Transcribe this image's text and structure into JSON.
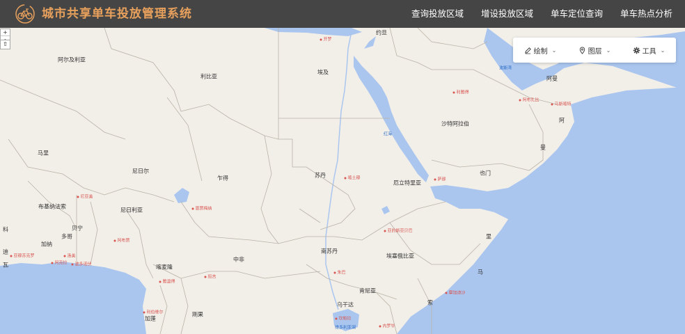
{
  "header": {
    "title": "城市共享单车投放管理系统",
    "logo": "bicycle-logo"
  },
  "nav": [
    {
      "label": "查询投放区域"
    },
    {
      "label": "增设投放区域"
    },
    {
      "label": "单车定位查询"
    },
    {
      "label": "单车热点分析"
    }
  ],
  "zoom": {
    "in_label": "+",
    "out_label": "-",
    "reset_label": "⇧"
  },
  "toolbar": {
    "draw": {
      "label": "绘制",
      "icon": "pencil-icon"
    },
    "layers": {
      "label": "图层",
      "icon": "map-pin-icon"
    },
    "tools": {
      "label": "工具",
      "icon": "gear-icon"
    }
  },
  "map": {
    "countries": [
      {
        "name": "阿尔及利亚"
      },
      {
        "name": "利比亚"
      },
      {
        "name": "埃及"
      },
      {
        "name": "约旦"
      },
      {
        "name": "沙特阿拉伯"
      },
      {
        "name": "阿曼"
      },
      {
        "name": "阿"
      },
      {
        "name": "曼"
      },
      {
        "name": "马里"
      },
      {
        "name": "尼日尔"
      },
      {
        "name": "乍得"
      },
      {
        "name": "苏丹"
      },
      {
        "name": "厄立特里亚"
      },
      {
        "name": "也门"
      },
      {
        "name": "布基纳法索"
      },
      {
        "name": "贝宁"
      },
      {
        "name": "尼日利亚"
      },
      {
        "name": "加纳"
      },
      {
        "name": "多哥"
      },
      {
        "name": "科"
      },
      {
        "name": "迪"
      },
      {
        "name": "瓦"
      },
      {
        "name": "南苏丹"
      },
      {
        "name": "埃塞俄比亚"
      },
      {
        "name": "索"
      },
      {
        "name": "马"
      },
      {
        "name": "里"
      },
      {
        "name": "喀麦隆"
      },
      {
        "name": "中非"
      },
      {
        "name": "肯尼亚"
      },
      {
        "name": "乌干达"
      },
      {
        "name": "加蓬"
      },
      {
        "name": "刚果"
      }
    ],
    "cities": [
      {
        "name": "开罗"
      },
      {
        "name": "利雅得"
      },
      {
        "name": "阿布扎比"
      },
      {
        "name": "马斯喀特"
      },
      {
        "name": "喀土穆"
      },
      {
        "name": "萨那"
      },
      {
        "name": "恩贾梅纳"
      },
      {
        "name": "尼亚美"
      },
      {
        "name": "阿布贾"
      },
      {
        "name": "亚的斯亚贝巴"
      },
      {
        "name": "雅温得"
      },
      {
        "name": "班吉"
      },
      {
        "name": "朱巴"
      },
      {
        "name": "坎帕拉"
      },
      {
        "name": "内罗毕"
      },
      {
        "name": "摩加迪沙"
      },
      {
        "name": "利伯维尔"
      },
      {
        "name": "阿克拉"
      },
      {
        "name": "洛美"
      },
      {
        "name": "波多诺伏"
      },
      {
        "name": "亚穆苏克罗"
      }
    ],
    "waters": [
      {
        "name": "波斯湾"
      },
      {
        "name": "红海"
      },
      {
        "name": "维多利亚湖"
      }
    ]
  }
}
